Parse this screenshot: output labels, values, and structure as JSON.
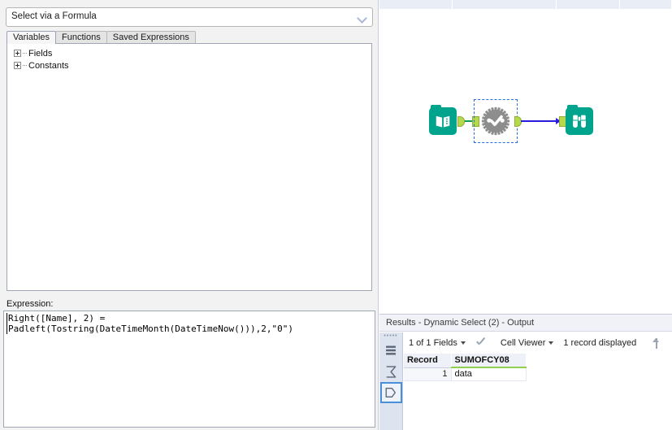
{
  "config_panel": {
    "formula_select": {
      "value": "Select via a Formula",
      "chevron_icon": "chevron-down-icon"
    },
    "tabs": [
      {
        "label": "Variables",
        "active": true
      },
      {
        "label": "Functions",
        "active": false
      },
      {
        "label": "Saved Expressions",
        "active": false
      }
    ],
    "tree": [
      {
        "label": "Fields",
        "expander": "plus-box-icon"
      },
      {
        "label": "Constants",
        "expander": "plus-box-icon"
      }
    ],
    "expression": {
      "label": "Expression:",
      "text": "Right([Name], 2) =\nPadleft(Tostring(DateTimeMonth(DateTimeNow())),2,\"0\")"
    }
  },
  "canvas": {
    "tools": [
      {
        "name": "input-data-tool",
        "icon": "book-icon",
        "color": "#00a38c",
        "selected": false
      },
      {
        "name": "dynamic-select-tool",
        "icon": "gear-check-icon",
        "color": "#8a8a8a",
        "selected": true
      },
      {
        "name": "browse-tool",
        "icon": "binoculars-icon",
        "color": "#00a38c",
        "selected": false
      }
    ],
    "connections": [
      {
        "from": "input-data-tool",
        "to": "dynamic-select-tool",
        "color": "#0d9e4c"
      },
      {
        "from": "dynamic-select-tool",
        "to": "browse-tool",
        "color": "#2a1be0"
      }
    ],
    "anchor_color": "#b5d94a",
    "selection_color": "#1f6fe0"
  },
  "results": {
    "title": "Results - Dynamic Select (2) - Output",
    "rail": [
      {
        "name": "records-icon",
        "selected": false
      },
      {
        "name": "sigma-icon",
        "selected": false
      },
      {
        "name": "messages-tag-icon",
        "selected": true
      }
    ],
    "toolbar": {
      "fields_label": "1 of 1 Fields",
      "check_icon": "checkmark-icon",
      "cell_viewer_label": "Cell Viewer",
      "record_count_label": "1 record displayed",
      "up_icon": "arrow-up-icon",
      "down_icon": "arrow-down-icon"
    },
    "grid": {
      "columns": [
        "Record",
        "SUMOFCY08"
      ],
      "rows": [
        {
          "record": "1",
          "value": "data"
        }
      ],
      "header_underline_color": "#8fd14f"
    }
  }
}
